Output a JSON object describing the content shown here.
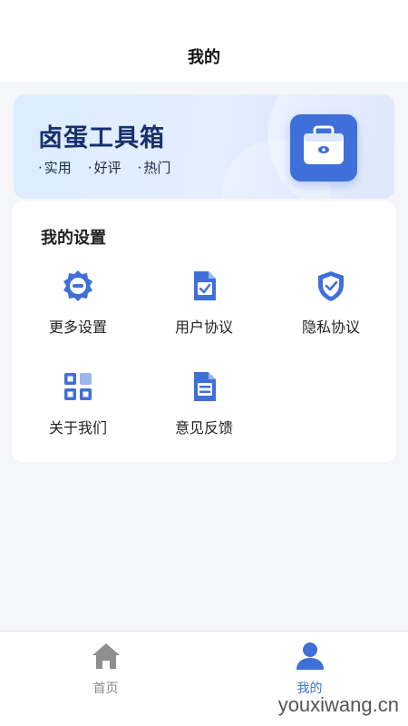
{
  "header": {
    "title": "我的"
  },
  "banner": {
    "app_name": "卤蛋工具箱",
    "tags": [
      "实用",
      "好评",
      "热门"
    ],
    "icon": "toolbox-icon"
  },
  "settings": {
    "title": "我的设置",
    "items": [
      {
        "label": "更多设置",
        "icon": "gear-icon"
      },
      {
        "label": "用户协议",
        "icon": "document-check-icon"
      },
      {
        "label": "隐私协议",
        "icon": "shield-check-icon"
      },
      {
        "label": "关于我们",
        "icon": "grid-icon"
      },
      {
        "label": "意见反馈",
        "icon": "feedback-document-icon"
      }
    ]
  },
  "tabbar": {
    "items": [
      {
        "label": "首页",
        "icon": "home-icon",
        "active": false
      },
      {
        "label": "我的",
        "icon": "user-icon",
        "active": true
      }
    ]
  },
  "colors": {
    "accent": "#3f6fd8",
    "inactive": "#888888"
  },
  "watermark": "youxiwang.cn"
}
